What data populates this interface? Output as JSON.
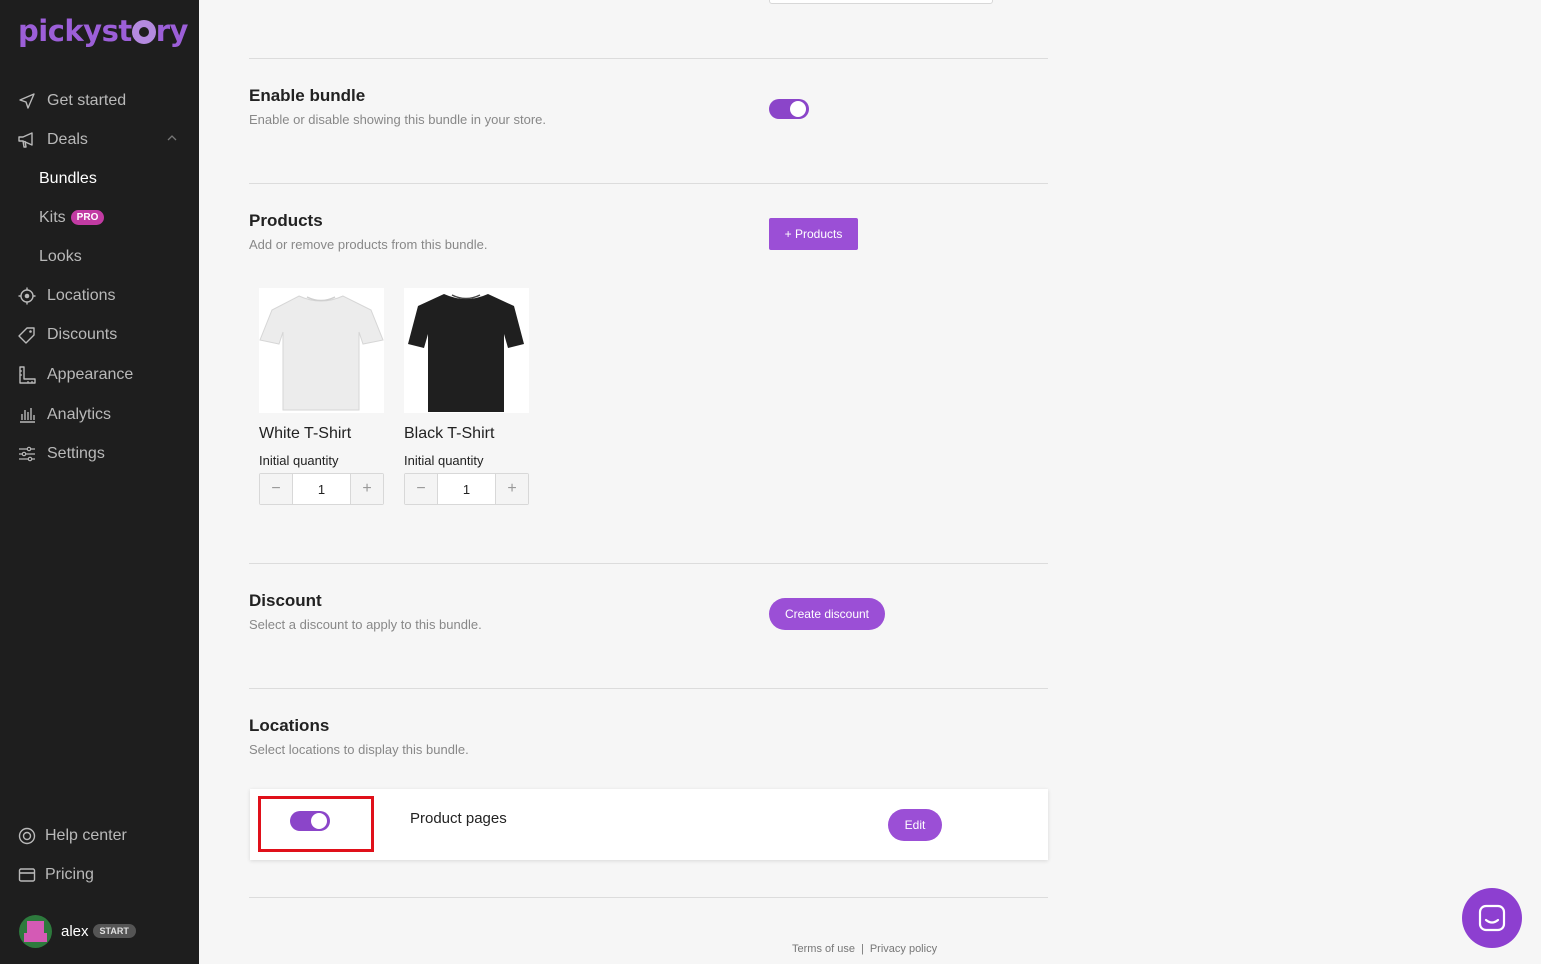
{
  "brand": {
    "name": "pickystory",
    "accent": "#9b4fd6"
  },
  "sidebar": {
    "items": [
      {
        "label": "Get started",
        "icon": "send-icon"
      },
      {
        "label": "Deals",
        "icon": "megaphone-icon"
      },
      {
        "label": "Bundles"
      },
      {
        "label": "Kits",
        "badge": "PRO"
      },
      {
        "label": "Looks"
      },
      {
        "label": "Locations",
        "icon": "target-icon"
      },
      {
        "label": "Discounts",
        "icon": "tag-icon"
      },
      {
        "label": "Appearance",
        "icon": "ruler-icon"
      },
      {
        "label": "Analytics",
        "icon": "bar-chart-icon"
      },
      {
        "label": "Settings",
        "icon": "sliders-icon"
      }
    ],
    "footer": [
      {
        "label": "Help center",
        "icon": "lifebuoy-icon"
      },
      {
        "label": "Pricing",
        "icon": "credit-card-icon"
      }
    ],
    "user": {
      "name": "alex",
      "plan": "START"
    }
  },
  "sections": {
    "enable": {
      "title": "Enable bundle",
      "desc": "Enable or disable showing this bundle in your store.",
      "enabled": true
    },
    "products": {
      "title": "Products",
      "desc": "Add or remove products from this bundle.",
      "add_label": "+ Products",
      "items": [
        {
          "name": "White T-Shirt",
          "qty_label": "Initial quantity",
          "qty": "1",
          "color": "#ffffff"
        },
        {
          "name": "Black T-Shirt",
          "qty_label": "Initial quantity",
          "qty": "1",
          "color": "#1f1f1f"
        }
      ]
    },
    "discount": {
      "title": "Discount",
      "desc": "Select a discount to apply to this bundle.",
      "button": "Create discount"
    },
    "locations": {
      "title": "Locations",
      "desc": "Select locations to display this bundle.",
      "item": {
        "name": "Product pages",
        "enabled": true,
        "button": "Edit"
      }
    }
  },
  "footer": {
    "terms": "Terms of use",
    "sep": "|",
    "privacy": "Privacy policy"
  }
}
